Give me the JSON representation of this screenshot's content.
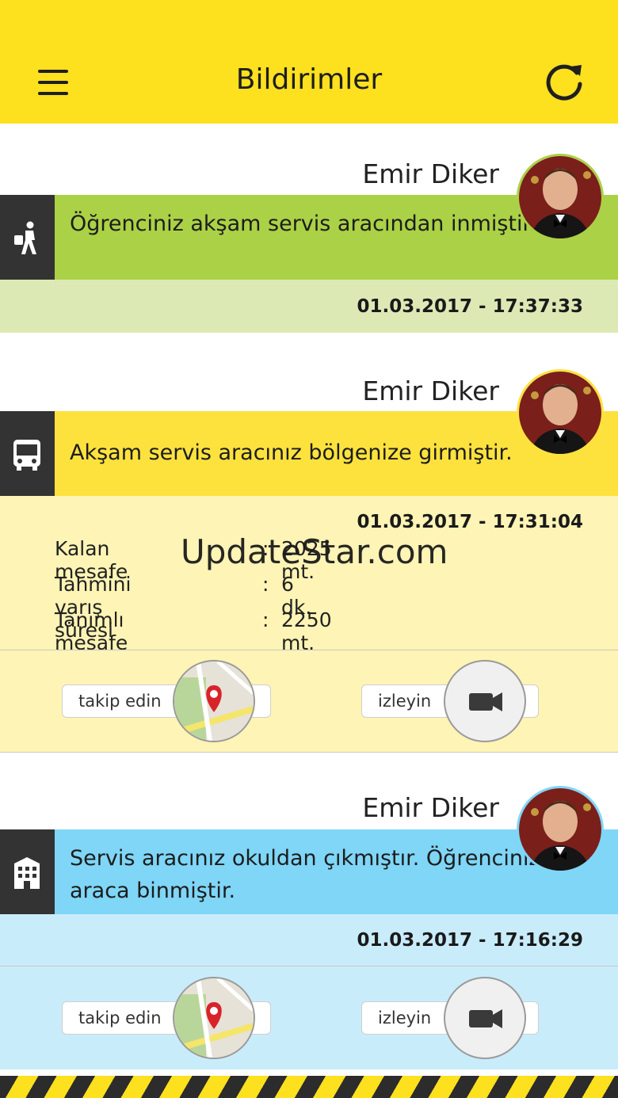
{
  "header": {
    "title": "Bildirimler",
    "menu_icon": "hamburger-menu-icon",
    "refresh_icon": "refresh-icon",
    "background": "#fde01e"
  },
  "notifications": [
    {
      "name": "Emir Diker",
      "icon": "walking-student-icon",
      "message": "Öğrenciniz akşam servis aracından inmiştir.",
      "datetime": "01.03.2017 - 17:37:33",
      "message_color": "#abd146",
      "band_color": "#dce9b5"
    },
    {
      "name": "Emir Diker",
      "icon": "bus-icon",
      "message": "Akşam servis aracınız bölgenize girmiştir.",
      "datetime": "01.03.2017 - 17:31:04",
      "message_color": "#fde23e",
      "band_color": "#fef4b5",
      "details": [
        {
          "label": "Kalan mesafe",
          "colon": ":",
          "value": "2025 mt."
        },
        {
          "label": "Tahmini varış süresi",
          "colon": ":",
          "value": "6 dk."
        },
        {
          "label": "Tanımlı mesafe",
          "colon": ":",
          "value": "2250 mt."
        }
      ],
      "track_label": "takip edin",
      "watch_label": "izleyin"
    },
    {
      "name": "Emir Diker",
      "icon": "building-icon",
      "message": "Servis aracınız okuldan çıkmıştır. Öğrenciniz araca binmiştir.",
      "datetime": "01.03.2017 - 17:16:29",
      "message_color": "#7fd6f7",
      "band_color": "#c9ecfb",
      "track_label": "takip edin",
      "watch_label": "izleyin"
    }
  ],
  "watermark": "UpdateStar.com"
}
